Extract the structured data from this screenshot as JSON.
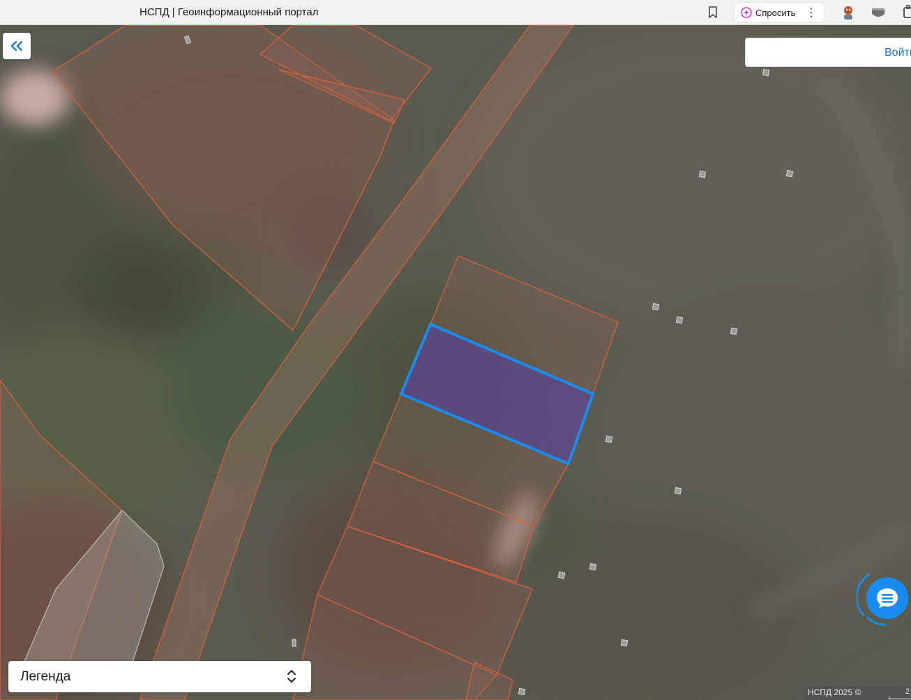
{
  "browser": {
    "tab_title": "НСПД | Геоинформационный портал",
    "ask_label": "Спросить",
    "ask_more": "⋮"
  },
  "map": {
    "selected_parcel_color": "#1a8cf0",
    "parcel_outline_color": "#e0603a"
  },
  "controls": {
    "collapse_icon": "«",
    "login_label": "Войти"
  },
  "legend": {
    "label": "Легенда"
  },
  "attribution": {
    "text": "НСПД 2025 ©",
    "scale_label": "2"
  }
}
